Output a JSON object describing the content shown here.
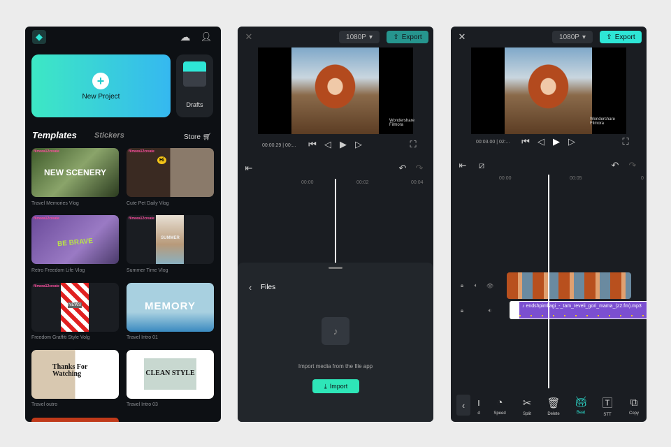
{
  "home": {
    "new_project": "New Project",
    "drafts": "Drafts",
    "tabs": [
      "Templates",
      "Stickers"
    ],
    "store": "Store",
    "watermark": "filmora12create",
    "templates": [
      {
        "title": "Travel Memories Vlog",
        "overlay": "NEW SCENERY"
      },
      {
        "title": "Cute Pet Daily Vlog",
        "overlay": "Hi"
      },
      {
        "title": "Retro Freedom Life Vlog",
        "overlay": "BE BRAVE"
      },
      {
        "title": "Summer Time Vlog",
        "overlay": "SUMMER"
      },
      {
        "title": "Freedom Graffiti Style Volg",
        "overlay": "NEWS"
      },
      {
        "title": "Travel Intro 01",
        "overlay": "MEMORY"
      },
      {
        "title": "Travel outro",
        "overlay": "Thanks For Watching"
      },
      {
        "title": "Travel Intro 03",
        "overlay": "CLEAN STYLE"
      }
    ]
  },
  "editor1": {
    "resolution": "1080P",
    "export": "Export",
    "watermark": "Wondershare Filmora",
    "time": "00:00.29",
    "time_total": "00:...",
    "ruler": [
      "00:00",
      "00:02",
      "00:04"
    ],
    "files_title": "Files",
    "import_hint": "Import media from the file app",
    "import": "Import"
  },
  "editor2": {
    "resolution": "1080P",
    "export": "Export",
    "watermark": "Wondershare Filmora",
    "time": "00:03.00",
    "time_total": "02:...",
    "ruler": [
      "00:00",
      "00:05",
      "0"
    ],
    "audio_clip": "endshpimljagi_-_tam_reveli_gori_mama_(z2.fm).mp3",
    "tools": [
      {
        "label": "d"
      },
      {
        "label": "Speed"
      },
      {
        "label": "Split"
      },
      {
        "label": "Delete"
      },
      {
        "label": "Beat"
      },
      {
        "label": "STT"
      },
      {
        "label": "Copy"
      }
    ]
  },
  "colors": {
    "accent": "#2ee6d6",
    "audio": "#7b4fd0"
  }
}
